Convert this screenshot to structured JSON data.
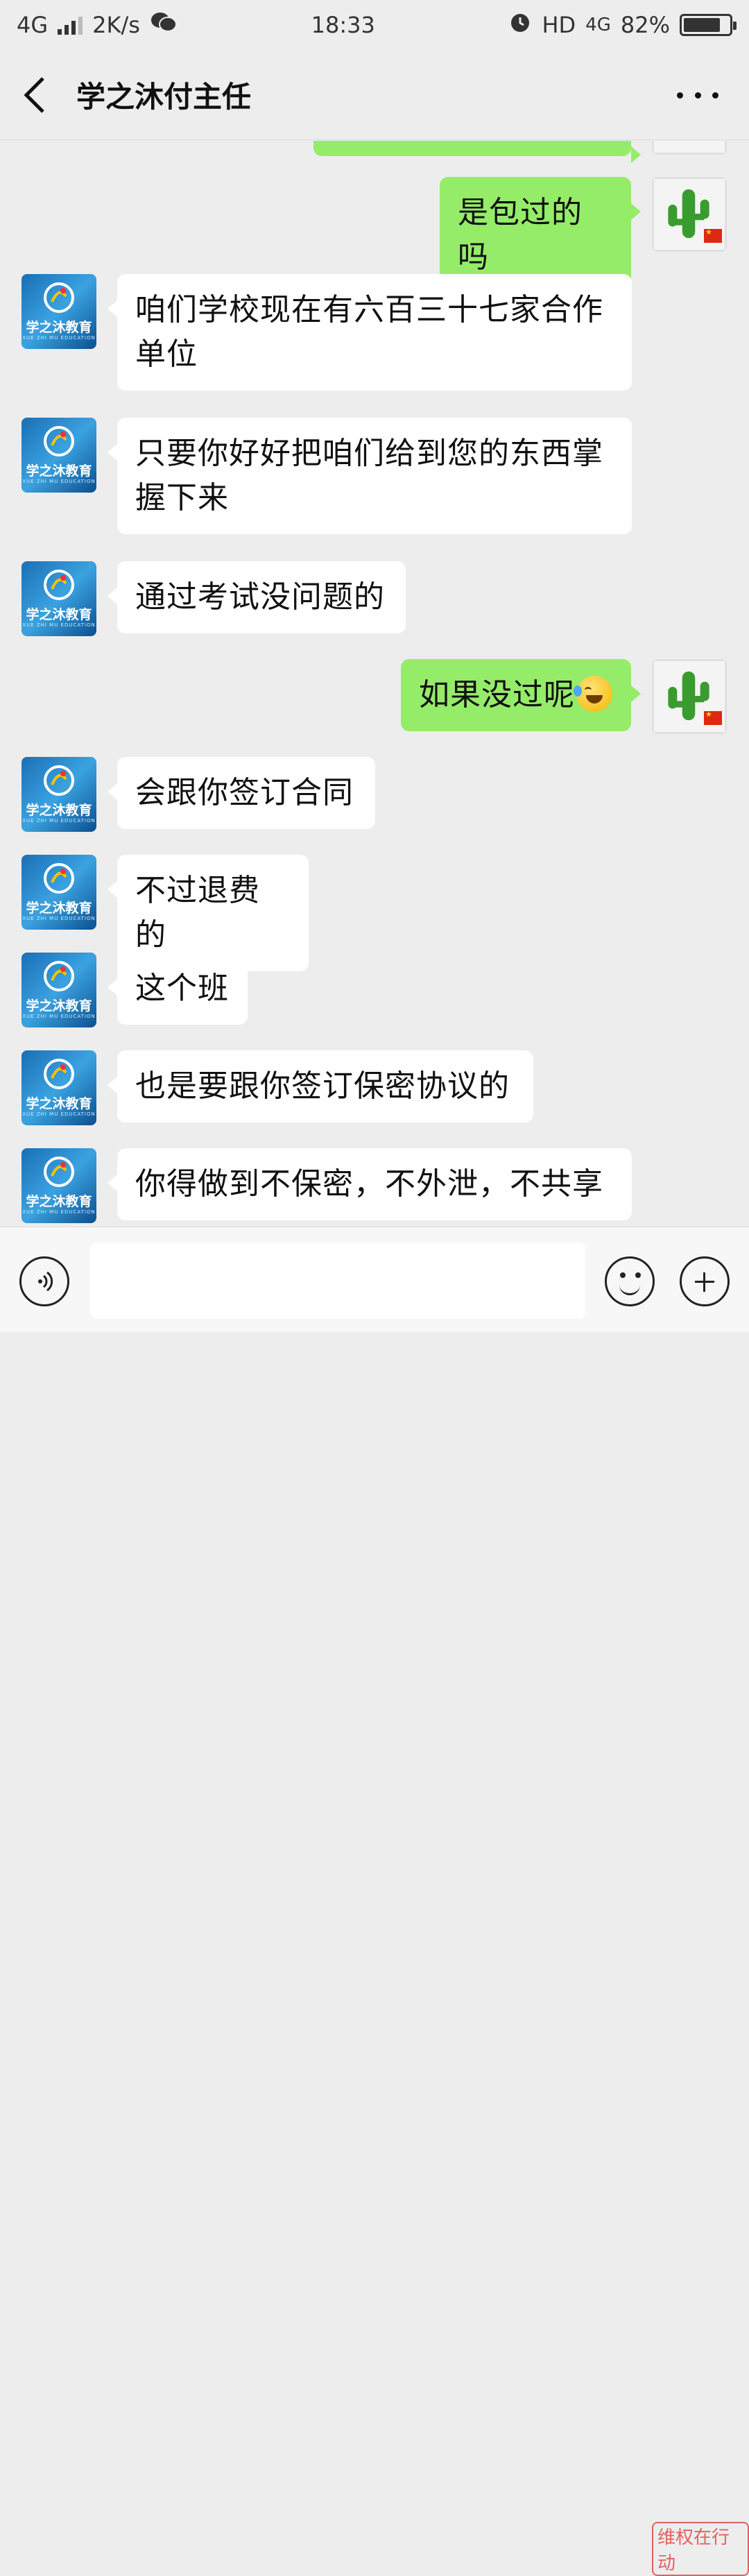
{
  "status_bar": {
    "network": "4G",
    "speed": "2K/s",
    "time": "18:33",
    "hd": "HD",
    "network_right": "4G",
    "battery": "82%",
    "battery_level": 0.82
  },
  "header": {
    "title": "学之沐付主任"
  },
  "contacts": {
    "school_avatar_text": "学之沐教育",
    "school_avatar_sub": "XUE ZHI MU EDUCATION"
  },
  "messages": [
    {
      "side": "right",
      "text": "是包过的吗"
    },
    {
      "side": "left",
      "text": "咱们学校现在有六百三十七家合作单位"
    },
    {
      "side": "left",
      "text": "只要你好好把咱们给到您的东西掌握下来"
    },
    {
      "side": "left",
      "text": "通过考试没问题的"
    },
    {
      "side": "right",
      "text": "如果没过呢"
    },
    {
      "side": "left",
      "text": "会跟你签订合同"
    },
    {
      "side": "left",
      "text": "不过退费的"
    },
    {
      "side": "left",
      "text": "这个班"
    },
    {
      "side": "left",
      "text": "也是要跟你签订保密协议的"
    },
    {
      "side": "left",
      "text": "你得做到不保密，不外泄，不共享"
    }
  ],
  "icons": {
    "back": "chevron-left-icon",
    "more": "more-dots-icon",
    "voice": "voice-icon",
    "emoji": "emoji-icon",
    "plus": "plus-icon"
  },
  "colors": {
    "background": "#ededed",
    "sent_bubble": "#95ec69",
    "received_bubble": "#ffffff"
  },
  "watermark": "维权在行动"
}
